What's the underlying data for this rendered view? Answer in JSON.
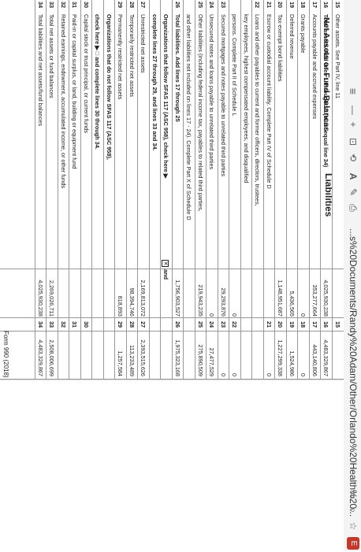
{
  "browser": {
    "url": "...s%20Documents/Randy%20Adam/Other/Orlando%20Health%20...",
    "ext_label": "E"
  },
  "liabilities_header": "Liabilities",
  "net_assets_header": "Net Assets or Fund Balances",
  "rows": [
    {
      "ln": "15",
      "desc": "Other assets. See Part IV, line 11",
      "a": "",
      "na": "15",
      "b": ""
    },
    {
      "ln": "16",
      "desc": "Total assets. Add lines 1 through 15 (must equal line 34)",
      "a": "4,025,930,238",
      "na": "16",
      "b": "4,483,329,867"
    },
    {
      "ln": "17",
      "desc": "Accounts payable and accrued expenses",
      "a": "353,277,664",
      "na": "17",
      "b": "443,140,806"
    },
    {
      "ln": "18",
      "desc": "Grants payable",
      "a": "0",
      "na": "18",
      "b": "0"
    },
    {
      "ln": "19",
      "desc": "Deferred revenue",
      "a": "5,436,565",
      "na": "19",
      "b": "1,524,986"
    },
    {
      "ln": "20",
      "desc": "Tax-exempt bond liabilities",
      "a": "1,148,951,687",
      "na": "20",
      "b": "1,227,299,338"
    },
    {
      "ln": "21",
      "desc": "Escrow or custodial account liability. Complete Part IV of Schedule D",
      "a": "",
      "na": "21",
      "b": "0"
    },
    {
      "ln": "22",
      "desc": "Loans and other payables to current and former officers, directors, trustees,",
      "a": "",
      "na": "",
      "b": ""
    },
    {
      "ln": "",
      "desc": "key employees, highest compensated employees, and disqualified",
      "a": "",
      "na": "",
      "b": ""
    },
    {
      "ln": "",
      "desc": "persons. Complete Part II of Schedule L",
      "a": "0",
      "na": "22",
      "b": "0"
    },
    {
      "ln": "23",
      "desc": "Secured mortgages and notes payable to unrelated third parties",
      "a": "29,293,876",
      "na": "23",
      "b": "0"
    },
    {
      "ln": "24",
      "desc": "Unsecured notes and loans payable to unrelated third parties",
      "a": "0",
      "na": "24",
      "b": "27,477,529"
    },
    {
      "ln": "25",
      "desc": "Other liabilities (including federal income tax, payables to related third parties,",
      "a": "219,943,235",
      "na": "25",
      "b": "275,890,509"
    },
    {
      "ln": "",
      "desc": "and other liabilities not included on lines 17 - 24). Complete Part X of Schedule D",
      "a": "",
      "na": "",
      "b": ""
    },
    {
      "ln": "26",
      "desc": "Total liabilities. Add lines 17 through 25",
      "a": "1,756,903,527",
      "na": "26",
      "b": "1,975,323,168"
    },
    {
      "ln": "",
      "desc": "Organizations that follow SFAS 117 (ASC 958), check here ▶",
      "a": "",
      "na": "",
      "b": ""
    },
    {
      "ln": "",
      "desc": "complete lines 27 through 29, and lines 33 and 34.",
      "a": "",
      "na": "",
      "b": ""
    },
    {
      "ln": "27",
      "desc": "Unrestricted net assets",
      "a": "2,169,813,072",
      "na": "27",
      "b": "2,393,515,626"
    },
    {
      "ln": "28",
      "desc": "Temporarily restricted net assets",
      "a": "98,394,746",
      "na": "28",
      "b": "113,233,489"
    },
    {
      "ln": "29",
      "desc": "Permanently restricted net assets",
      "a": "818,893",
      "na": "29",
      "b": "1,257,584"
    },
    {
      "ln": "",
      "desc": "Organizations that do not follow SFAS 117 (ASC 958),",
      "a": "",
      "na": "",
      "b": ""
    },
    {
      "ln": "",
      "desc": "check here ▶ □ and complete lines 30 through 34.",
      "a": "",
      "na": "",
      "b": ""
    },
    {
      "ln": "30",
      "desc": "Capital stock or trust principal, or current funds",
      "a": "",
      "na": "30",
      "b": ""
    },
    {
      "ln": "31",
      "desc": "Paid-in or capital surplus, or land, building or equipment fund",
      "a": "",
      "na": "31",
      "b": ""
    },
    {
      "ln": "32",
      "desc": "Retained earnings, endowment, accumulated income, or other funds",
      "a": "",
      "na": "32",
      "b": ""
    },
    {
      "ln": "33",
      "desc": "Total net assets or fund balances",
      "a": "2,269,026,711",
      "na": "33",
      "b": "2,508,006,699"
    },
    {
      "ln": "34",
      "desc": "Total liabilities and net assets/fund balances",
      "a": "4,025,930,238",
      "na": "34",
      "b": "4,483,329,867"
    }
  ],
  "sfas_and": "and",
  "footer_form": "Form 990 (2018)"
}
